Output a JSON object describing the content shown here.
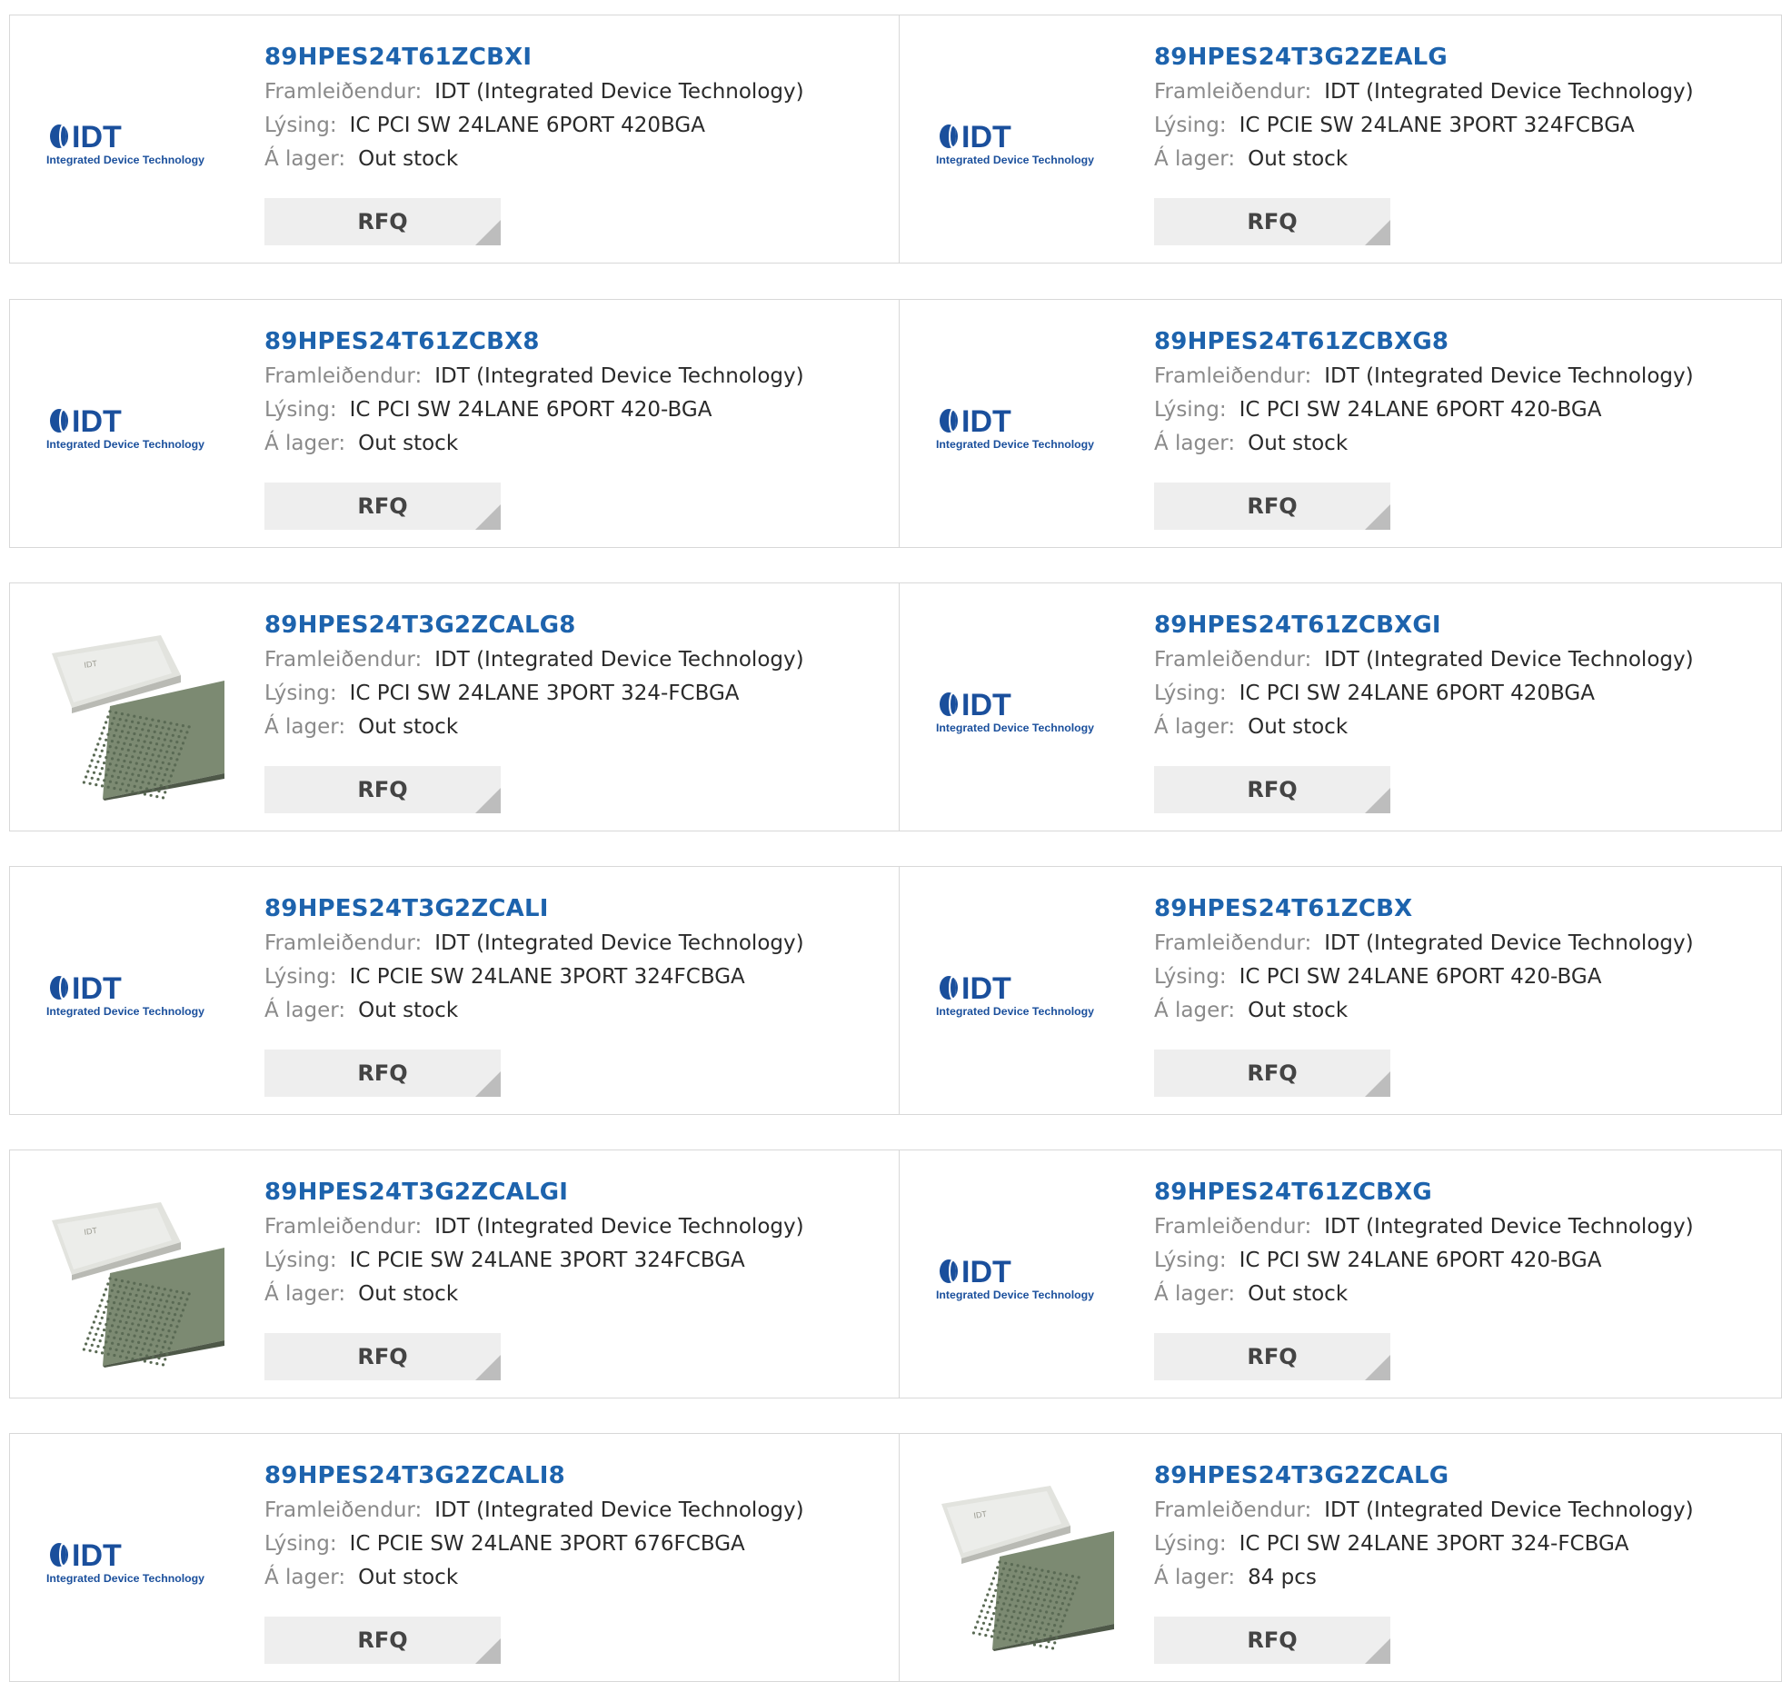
{
  "labels": {
    "manufacturer": "Framleiðendur:",
    "description": "Lýsing:",
    "stock": "Á lager:"
  },
  "logo": {
    "text": "IDT",
    "sub": "Integrated Device Technology"
  },
  "rows": [
    [
      {
        "pn": "89HPES24T61ZCBXI",
        "thumb": "idt-logo",
        "manufacturer": "IDT (Integrated Device Technology)",
        "description": "IC PCI SW 24LANE 6PORT 420BGA",
        "stock": "Out stock",
        "button": "RFQ"
      },
      {
        "pn": "89HPES24T3G2ZEALG",
        "thumb": "idt-logo",
        "manufacturer": "IDT (Integrated Device Technology)",
        "description": "IC PCIE SW 24LANE 3PORT 324FCBGA",
        "stock": "Out stock",
        "button": "RFQ"
      }
    ],
    [
      {
        "pn": "89HPES24T61ZCBX8",
        "thumb": "idt-logo",
        "manufacturer": "IDT (Integrated Device Technology)",
        "description": "IC PCI SW 24LANE 6PORT 420-BGA",
        "stock": "Out stock",
        "button": "RFQ"
      },
      {
        "pn": "89HPES24T61ZCBXG8",
        "thumb": "idt-logo",
        "manufacturer": "IDT (Integrated Device Technology)",
        "description": "IC PCI SW 24LANE 6PORT 420-BGA",
        "stock": "Out stock",
        "button": "RFQ"
      }
    ],
    [
      {
        "pn": "89HPES24T3G2ZCALG8",
        "thumb": "chip-photo",
        "manufacturer": "IDT (Integrated Device Technology)",
        "description": "IC PCI SW 24LANE 3PORT 324-FCBGA",
        "stock": "Out stock",
        "button": "RFQ"
      },
      {
        "pn": "89HPES24T61ZCBXGI",
        "thumb": "idt-logo",
        "manufacturer": "IDT (Integrated Device Technology)",
        "description": "IC PCI SW 24LANE 6PORT 420BGA",
        "stock": "Out stock",
        "button": "RFQ"
      }
    ],
    [
      {
        "pn": "89HPES24T3G2ZCALI",
        "thumb": "idt-logo",
        "manufacturer": "IDT (Integrated Device Technology)",
        "description": "IC PCIE SW 24LANE 3PORT 324FCBGA",
        "stock": "Out stock",
        "button": "RFQ"
      },
      {
        "pn": "89HPES24T61ZCBX",
        "thumb": "idt-logo",
        "manufacturer": "IDT (Integrated Device Technology)",
        "description": "IC PCI SW 24LANE 6PORT 420-BGA",
        "stock": "Out stock",
        "button": "RFQ"
      }
    ],
    [
      {
        "pn": "89HPES24T3G2ZCALGI",
        "thumb": "chip-photo",
        "manufacturer": "IDT (Integrated Device Technology)",
        "description": "IC PCIE SW 24LANE 3PORT 324FCBGA",
        "stock": "Out stock",
        "button": "RFQ"
      },
      {
        "pn": "89HPES24T61ZCBXG",
        "thumb": "idt-logo",
        "manufacturer": "IDT (Integrated Device Technology)",
        "description": "IC PCI SW 24LANE 6PORT 420-BGA",
        "stock": "Out stock",
        "button": "RFQ"
      }
    ],
    [
      {
        "pn": "89HPES24T3G2ZCALI8",
        "thumb": "idt-logo",
        "manufacturer": "IDT (Integrated Device Technology)",
        "description": "IC PCIE SW 24LANE 3PORT 676FCBGA",
        "stock": "Out stock",
        "button": "RFQ"
      },
      {
        "pn": "89HPES24T3G2ZCALG",
        "thumb": "chip-photo",
        "manufacturer": "IDT (Integrated Device Technology)",
        "description": "IC PCI SW 24LANE 3PORT 324-FCBGA",
        "stock": "84 pcs",
        "button": "RFQ"
      }
    ]
  ],
  "colors": {
    "link": "#1d63ad",
    "logo_blue": "#1a4f9c",
    "rfq_bg": "#eeeeee",
    "border": "#d8d8d8"
  }
}
